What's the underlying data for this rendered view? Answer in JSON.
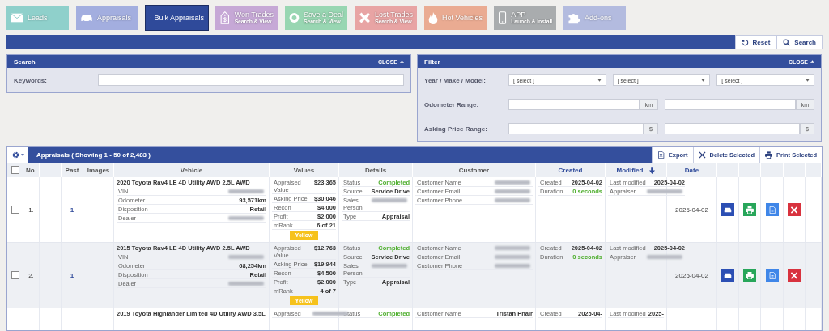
{
  "nav": [
    {
      "label": "Leads",
      "color": "#8fd0cb",
      "selected": false
    },
    {
      "label": "Appraisals",
      "color": "#a3aedf",
      "selected": false
    },
    {
      "label": "Bulk Appraisals",
      "color": "#2f4a9a",
      "selected": true
    },
    {
      "label": "Won Trades",
      "sublabel": "Search & View",
      "color": "#c6a8d6",
      "selected": false
    },
    {
      "label": "Save a Deal",
      "sublabel": "Search & View",
      "color": "#98d6b2",
      "selected": false
    },
    {
      "label": "Lost Trades",
      "sublabel": "Search & View",
      "color": "#e8a4a4",
      "selected": false
    },
    {
      "label": "Hot Vehicles",
      "color": "#eaab92",
      "selected": false
    },
    {
      "label": "APP",
      "sublabel": "Launch & Install",
      "color": "#a9acae",
      "selected": false
    },
    {
      "label": "Add-ons",
      "color": "#b3bbdf",
      "selected": false
    }
  ],
  "toolbar": {
    "buttons": [
      {
        "label": "Reset"
      },
      {
        "label": "Search"
      }
    ]
  },
  "search_panel": {
    "title": "Search",
    "close": "CLOSE",
    "fields": [
      {
        "label": "Keywords:"
      }
    ]
  },
  "filter_panel": {
    "title": "Filter",
    "close": "CLOSE",
    "rows": [
      {
        "label": "Year / Make / Model:",
        "kind": "selects",
        "selects": [
          "[ select ]",
          "[ select ]",
          "[ select ]"
        ]
      },
      {
        "label": "Odometer Range:",
        "kind": "range",
        "units": [
          "km",
          "km"
        ]
      },
      {
        "label": "Asking Price Range:",
        "kind": "range",
        "units": [
          "$",
          "$"
        ]
      }
    ]
  },
  "table": {
    "title": "Appraisals ( Showing 1 - 50 of 2,483 )",
    "select_all_checked": false,
    "actions": [
      {
        "label": "Export"
      },
      {
        "label": "Delete Selected"
      },
      {
        "label": "Print Selected"
      }
    ],
    "columns": [
      {
        "label": "No.",
        "sortable": false,
        "sorted": false
      },
      {
        "label": "Past",
        "sortable": false,
        "sorted": false
      },
      {
        "label": "Images",
        "sortable": false,
        "sorted": false
      },
      {
        "label": "Vehicle",
        "sortable": false,
        "sorted": false
      },
      {
        "label": "Values",
        "sortable": false,
        "sorted": false
      },
      {
        "label": "Details",
        "sortable": false,
        "sorted": false
      },
      {
        "label": "Customer",
        "sortable": false,
        "sorted": false
      },
      {
        "label": "Created",
        "sortable": true,
        "sorted": false
      },
      {
        "label": "Modified",
        "sortable": true,
        "sorted": true
      },
      {
        "label": "Date",
        "sortable": true,
        "sorted": false
      }
    ],
    "rows": [
      {
        "checked": false,
        "no": "1.",
        "past": "1",
        "vehicle": {
          "title": "2020 Toyota Rav4 LE 4D Utility AWD 2.5L AWD",
          "fields": [
            {
              "label": "VIN",
              "kind": "blurred"
            },
            {
              "label": "Odometer",
              "kind": "text",
              "value": "93,571km"
            },
            {
              "label": "Disposition",
              "kind": "text",
              "value": "Retail"
            },
            {
              "label": "Dealer",
              "kind": "blurred"
            }
          ]
        },
        "values": [
          {
            "label": "Appraised Value",
            "kind": "text",
            "value": "$23,365"
          },
          {
            "label": "Asking Price",
            "kind": "text",
            "value": "$30,046"
          },
          {
            "label": "Recon",
            "kind": "text",
            "value": "$4,000"
          },
          {
            "label": "Profit",
            "kind": "text",
            "value": "$2,000"
          },
          {
            "label": "mRank",
            "kind": "text",
            "value": "6 of 21"
          }
        ],
        "badge": "Yellow",
        "details": [
          {
            "label": "Status",
            "kind": "status",
            "value": "Completed"
          },
          {
            "label": "Source",
            "kind": "text",
            "value": "Service Drive"
          },
          {
            "label": "Sales Person",
            "kind": "blurred"
          },
          {
            "label": "Type",
            "kind": "text",
            "value": "Appraisal"
          }
        ],
        "customer": [
          {
            "label": "Customer Name",
            "kind": "blurred"
          },
          {
            "label": "Customer Email",
            "kind": "blurred"
          },
          {
            "label": "Customer Phone",
            "kind": "blurred"
          }
        ],
        "created": [
          {
            "label": "Created",
            "kind": "text",
            "value": "2025-04-02"
          },
          {
            "label": "Duration",
            "kind": "status",
            "value": "0 seconds"
          }
        ],
        "modified": [
          {
            "label": "Last modified",
            "kind": "text",
            "value": "2025-04-02"
          },
          {
            "label": "Appraiser",
            "kind": "blurred"
          }
        ],
        "date": "2025-04-02"
      },
      {
        "checked": false,
        "no": "2.",
        "past": "1",
        "vehicle": {
          "title": "2015 Toyota Rav4 LE 4D Utility AWD 2.5L AWD",
          "fields": [
            {
              "label": "VIN",
              "kind": "blurred"
            },
            {
              "label": "Odometer",
              "kind": "text",
              "value": "68,254km"
            },
            {
              "label": "Disposition",
              "kind": "text",
              "value": "Retail"
            },
            {
              "label": "Dealer",
              "kind": "blurred"
            }
          ]
        },
        "values": [
          {
            "label": "Appraised Value",
            "kind": "text",
            "value": "$12,763"
          },
          {
            "label": "Asking Price",
            "kind": "text",
            "value": "$19,944"
          },
          {
            "label": "Recon",
            "kind": "text",
            "value": "$4,500"
          },
          {
            "label": "Profit",
            "kind": "text",
            "value": "$2,000"
          },
          {
            "label": "mRank",
            "kind": "text",
            "value": "4 of 7"
          }
        ],
        "badge": "Yellow",
        "details": [
          {
            "label": "Status",
            "kind": "status",
            "value": "Completed"
          },
          {
            "label": "Source",
            "kind": "text",
            "value": "Service Drive"
          },
          {
            "label": "Sales Person",
            "kind": "blurred"
          },
          {
            "label": "Type",
            "kind": "text",
            "value": "Appraisal"
          }
        ],
        "customer": [
          {
            "label": "Customer Name",
            "kind": "blurred"
          },
          {
            "label": "Customer Email",
            "kind": "blurred"
          },
          {
            "label": "Customer Phone",
            "kind": "blurred"
          }
        ],
        "created": [
          {
            "label": "Created",
            "kind": "text",
            "value": "2025-04-02"
          },
          {
            "label": "Duration",
            "kind": "status",
            "value": "0 seconds"
          }
        ],
        "modified": [
          {
            "label": "Last modified",
            "kind": "text",
            "value": "2025-04-02"
          },
          {
            "label": "Appraiser",
            "kind": "blurred"
          }
        ],
        "date": "2025-04-02"
      },
      {
        "vehicle": {
          "title": "2019 Toyota Highlander Limited 4D Utility AWD 3.5L"
        },
        "values": [
          {
            "label": "Appraised",
            "kind": "blurred"
          }
        ],
        "details": [
          {
            "label": "Status",
            "kind": "status",
            "value": "Completed"
          }
        ],
        "customer": [
          {
            "label": "Customer Name",
            "kind": "text",
            "value": "Tristan Phair"
          }
        ],
        "created": [
          {
            "label": "Created",
            "kind": "text",
            "value": "2025-04-"
          }
        ],
        "modified": [
          {
            "label": "Last modified",
            "kind": "text",
            "value": "2025-"
          }
        ]
      }
    ]
  }
}
